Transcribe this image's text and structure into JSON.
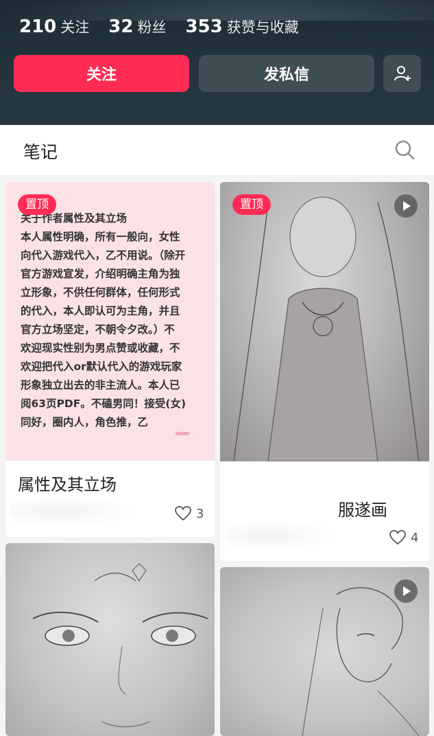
{
  "stats": [
    {
      "num": "210",
      "label": "关注"
    },
    {
      "num": "32",
      "label": "粉丝"
    },
    {
      "num": "353",
      "label": "获赞与收藏"
    }
  ],
  "actions": {
    "follow_label": "关注",
    "message_label": "发私信",
    "add_user_icon": "add-user-icon"
  },
  "tabs": {
    "notes_label": "笔记",
    "search_icon": "search-icon"
  },
  "colors": {
    "accent": "#fe2c55",
    "header_bg": "#24343e",
    "button_dark": "#3f4d55"
  },
  "notes": [
    {
      "pinned_label": "置顶",
      "body_lines": [
        "关于作者属性及其立场",
        "本人属性明确，所有一般向，女性",
        "向代入游戏代入，乙不用说。（除开",
        "官方游戏宣发，介绍明确主角为独",
        "立形象，不供任何群体，任何形式",
        "的代入，本人即认可为主角，并且",
        "官方立场坚定，不朝令夕改。）不",
        "欢迎现实性别为男点赞或收藏，不",
        "欢迎把代入or默认代入的游戏玩家",
        "形象独立出去的非主流人。本人已",
        "阅63页PDF。不磕男同！接受(女)",
        "同好，圈内人，角色推，乙"
      ],
      "title": "属性及其立场",
      "likes": "3"
    },
    {
      "pinned_label": "置顶",
      "has_video": true,
      "title": "服遂画",
      "likes": "4"
    },
    {
      "title": "",
      "likes": ""
    },
    {
      "has_video": true,
      "title": "",
      "likes": ""
    }
  ]
}
